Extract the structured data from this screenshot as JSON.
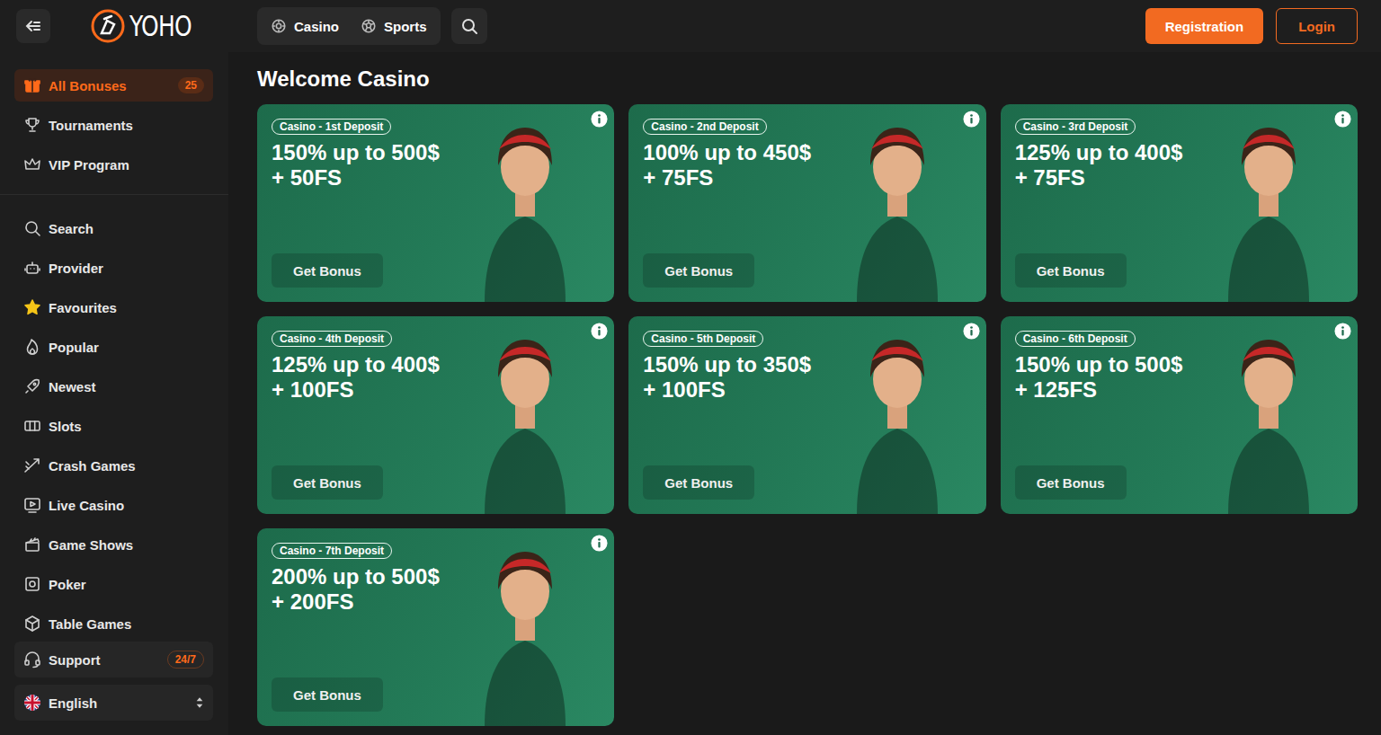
{
  "header": {
    "logo": "YOHO",
    "nav": [
      {
        "label": "Casino",
        "selected": false
      },
      {
        "label": "Sports",
        "selected": false
      }
    ],
    "register": "Registration",
    "login": "Login"
  },
  "sidebar": {
    "top_items": [
      {
        "label": "All Bonuses",
        "badge": "25",
        "selected": true
      },
      {
        "label": "Tournaments",
        "selected": false
      },
      {
        "label": "VIP Program",
        "selected": false
      }
    ],
    "items": [
      {
        "label": "Search",
        "selected": false
      },
      {
        "label": "Provider",
        "selected": false
      },
      {
        "label": "Favourites",
        "selected": false
      },
      {
        "label": "Popular",
        "selected": false
      },
      {
        "label": "Newest",
        "selected": false
      },
      {
        "label": "Slots",
        "selected": false
      },
      {
        "label": "Crash Games",
        "selected": false
      },
      {
        "label": "Live Casino",
        "selected": false
      },
      {
        "label": "Game Shows",
        "selected": false
      },
      {
        "label": "Poker",
        "selected": false
      },
      {
        "label": "Table Games",
        "selected": false
      }
    ],
    "support": {
      "label": "Support",
      "badge": "24/7"
    },
    "language": {
      "label": "English"
    }
  },
  "page": {
    "title": "Welcome Casino"
  },
  "cards": [
    {
      "tag": "Casino - 1st Deposit",
      "offer": "150% up to 500$",
      "spins": "+ 50FS",
      "button": "Get Bonus"
    },
    {
      "tag": "Casino - 2nd Deposit",
      "offer": "100% up to 450$",
      "spins": "+ 75FS",
      "button": "Get Bonus"
    },
    {
      "tag": "Casino - 3rd Deposit",
      "offer": "125% up to 400$",
      "spins": "+ 75FS",
      "button": "Get Bonus"
    },
    {
      "tag": "Casino - 4th Deposit",
      "offer": "125% up to 400$",
      "spins": "+ 100FS",
      "button": "Get Bonus"
    },
    {
      "tag": "Casino - 5th Deposit",
      "offer": "150% up to 350$",
      "spins": "+ 100FS",
      "button": "Get Bonus"
    },
    {
      "tag": "Casino - 6th Deposit",
      "offer": "150% up to 500$",
      "spins": "+ 125FS",
      "button": "Get Bonus"
    },
    {
      "tag": "Casino - 7th Deposit",
      "offer": "200% up to 500$",
      "spins": "+ 200FS",
      "button": "Get Bonus"
    }
  ]
}
